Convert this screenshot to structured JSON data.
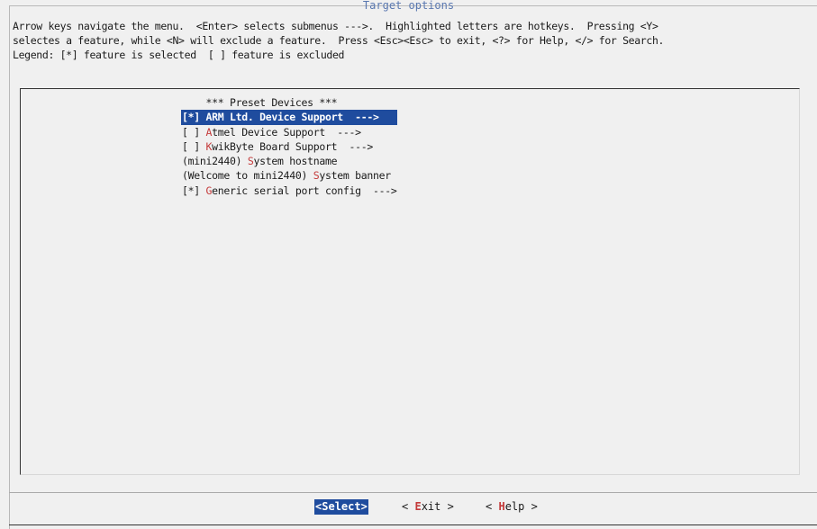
{
  "window": {
    "title": "Target options"
  },
  "help": {
    "line1": "Arrow keys navigate the menu.  <Enter> selects submenus --->.  Highlighted letters are hotkeys.  Pressing <Y>",
    "line2": "selectes a feature, while <N> will exclude a feature.  Press <Esc><Esc> to exit, <?> for Help, </> for Search.",
    "line3": "Legend: [*] feature is selected  [ ] feature is excluded"
  },
  "menu": {
    "items": [
      {
        "prefix": "    *** Preset Devices ***",
        "hotkey": "",
        "rest": "",
        "selected": false
      },
      {
        "prefix": "[*] ",
        "hotkey": "A",
        "rest": "RM Ltd. Device Support  --->",
        "selected": true
      },
      {
        "prefix": "[ ] ",
        "hotkey": "A",
        "rest": "tmel Device Support  --->",
        "selected": false
      },
      {
        "prefix": "[ ] ",
        "hotkey": "K",
        "rest": "wikByte Board Support  --->",
        "selected": false
      },
      {
        "prefix": "(mini2440) ",
        "hotkey": "S",
        "rest": "ystem hostname",
        "selected": false
      },
      {
        "prefix": "(Welcome to mini2440) ",
        "hotkey": "S",
        "rest": "ystem banner",
        "selected": false
      },
      {
        "prefix": "[*] ",
        "hotkey": "G",
        "rest": "eneric serial port config  --->",
        "selected": false
      }
    ]
  },
  "buttons": {
    "select": {
      "left": "<",
      "hotkey": "S",
      "rest": "elect>"
    },
    "exit": {
      "left": "< ",
      "hotkey": "E",
      "rest": "xit >"
    },
    "help": {
      "left": "< ",
      "hotkey": "H",
      "rest": "elp >"
    }
  },
  "colors": {
    "highlight": "#1f4c9e",
    "hotkey": "#c43a3a",
    "title": "#5a78b0"
  }
}
